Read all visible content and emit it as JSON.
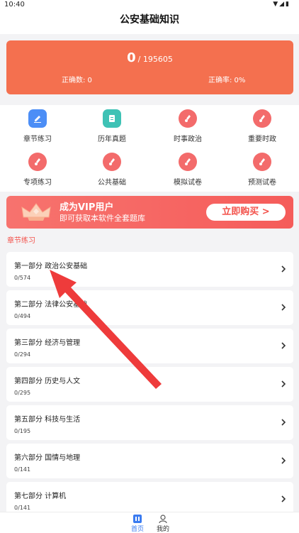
{
  "status_bar": {
    "time": "10:40",
    "icons": [
      "wifi-icon",
      "signal-icon",
      "battery-icon"
    ]
  },
  "header": {
    "title": "公安基础知识"
  },
  "score_card": {
    "correct_count": "0",
    "total": "/ 195605",
    "correct_label": "正确数: 0",
    "rate_label": "正确率: 0%"
  },
  "grid": [
    {
      "label": "章节练习",
      "icon": "pencil-icon"
    },
    {
      "label": "历年真题",
      "icon": "document-icon"
    },
    {
      "label": "时事政治",
      "icon": "brush-icon"
    },
    {
      "label": "重要时政",
      "icon": "brush-icon"
    },
    {
      "label": "专项练习",
      "icon": "brush-icon"
    },
    {
      "label": "公共基础",
      "icon": "brush-icon"
    },
    {
      "label": "模拟试卷",
      "icon": "brush-icon"
    },
    {
      "label": "预测试卷",
      "icon": "brush-icon"
    }
  ],
  "banner": {
    "title": "成为VIP用户",
    "subtitle": "即可获取本软件全套题库",
    "button": "立即购买 >"
  },
  "section": {
    "title": "章节练习"
  },
  "chapters": [
    {
      "name": "第一部分 政治公安基础",
      "progress": "0/574"
    },
    {
      "name": "第二部分 法律公安基础",
      "progress": "0/494"
    },
    {
      "name": "第三部分 经济与管理",
      "progress": "0/294"
    },
    {
      "name": "第四部分 历史与人文",
      "progress": "0/295"
    },
    {
      "name": "第五部分 科技与生活",
      "progress": "0/195"
    },
    {
      "name": "第六部分 国情与地理",
      "progress": "0/141"
    },
    {
      "name": "第七部分 计算机",
      "progress": "0/141"
    }
  ],
  "tabbar": {
    "home": "首页",
    "mine": "我的"
  },
  "colors": {
    "accent": "#f4704f",
    "banner": "#f55c5a",
    "tab_active": "#3a7bf0",
    "arrow": "#ee3b3b"
  }
}
